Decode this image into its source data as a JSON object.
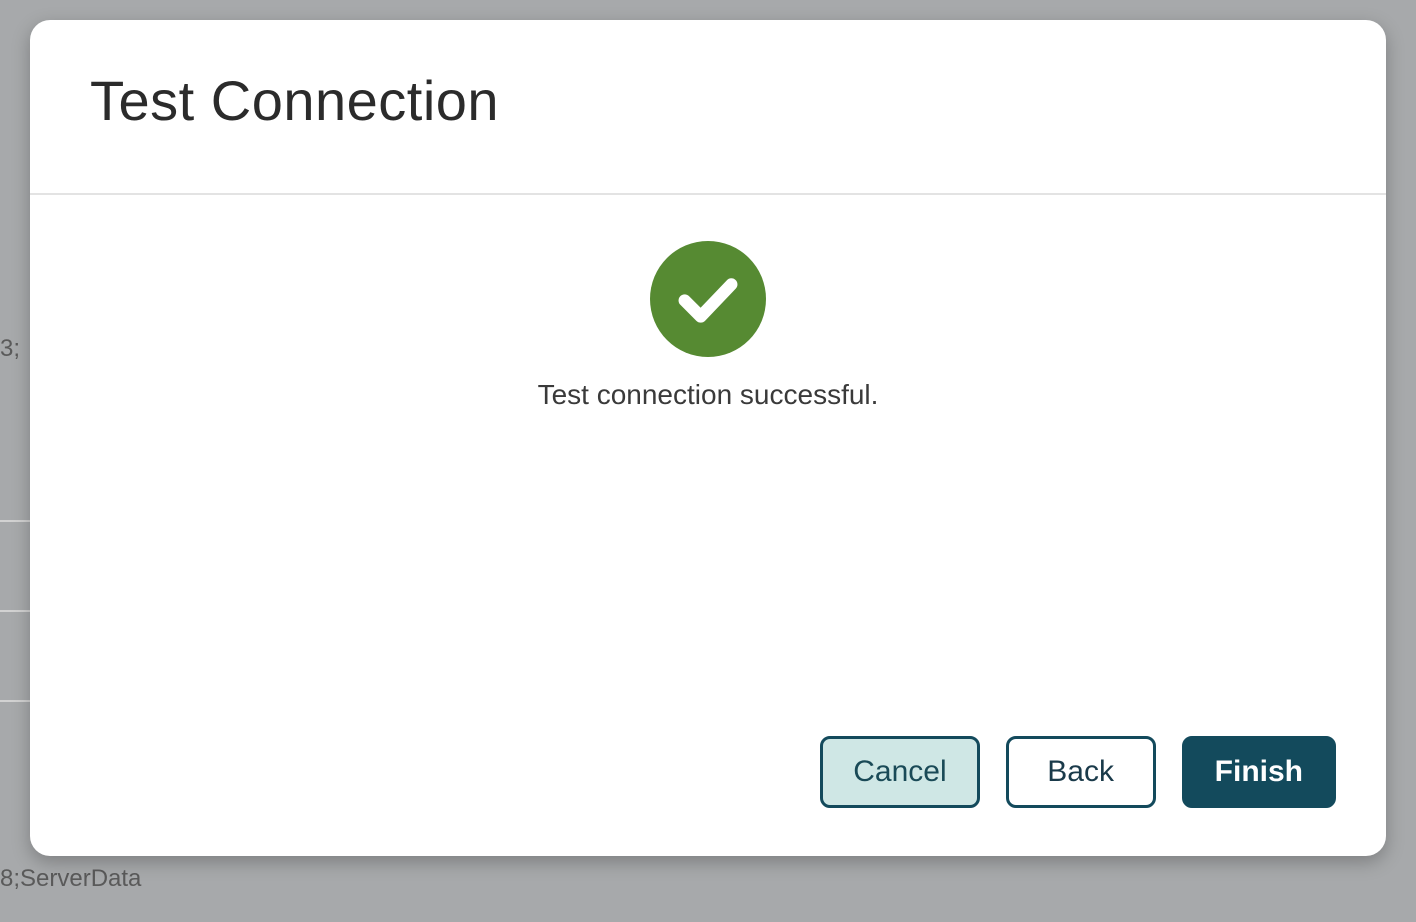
{
  "modal": {
    "title": "Test Connection",
    "status_message": "Test connection successful.",
    "icon": "check-icon",
    "icon_color": "#568a32"
  },
  "footer": {
    "cancel_label": "Cancel",
    "back_label": "Back",
    "finish_label": "Finish"
  },
  "background": {
    "fragment_top": "3;",
    "fragment_bottom": "8;ServerData"
  }
}
